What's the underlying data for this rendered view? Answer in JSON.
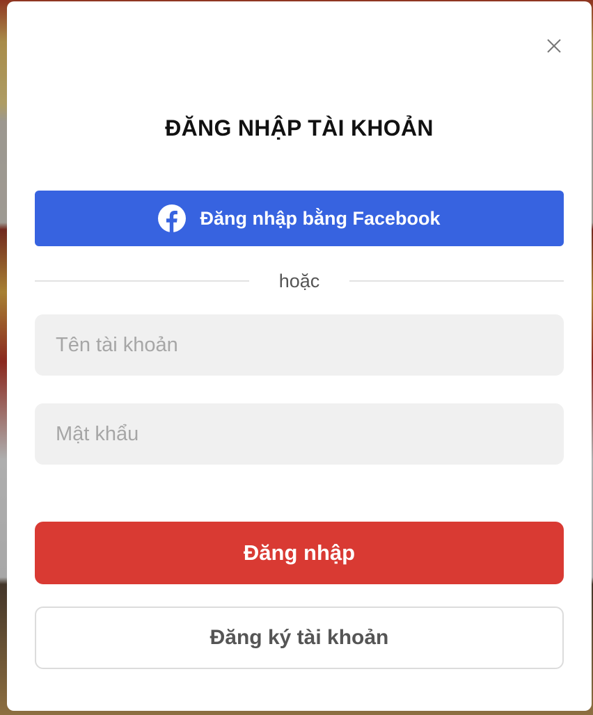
{
  "modal": {
    "title": "ĐĂNG NHẬP TÀI KHOẢN",
    "close_icon": "close-icon"
  },
  "facebook": {
    "label": "Đăng nhập bằng Facebook",
    "icon": "facebook-icon",
    "color": "#3763e0"
  },
  "divider": {
    "text": "hoặc"
  },
  "form": {
    "username": {
      "placeholder": "Tên tài khoản",
      "value": ""
    },
    "password": {
      "placeholder": "Mật khẩu",
      "value": ""
    }
  },
  "actions": {
    "login_label": "Đăng nhập",
    "login_color": "#d93a33",
    "register_label": "Đăng ký tài khoản"
  }
}
